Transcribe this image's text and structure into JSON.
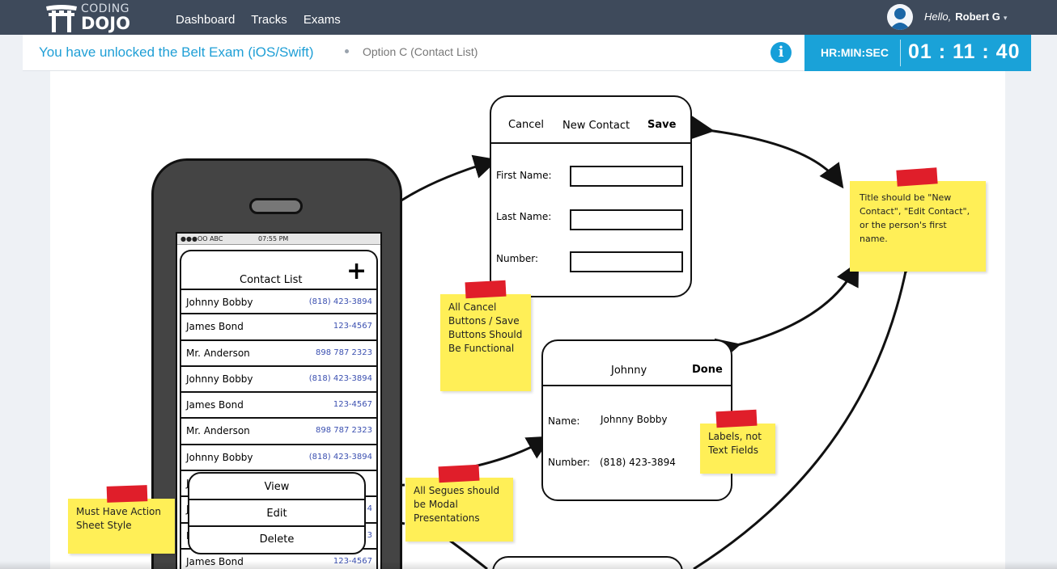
{
  "brand": {
    "line1": "CODING",
    "line2": "DOJO",
    "registered": "®"
  },
  "nav": {
    "links": [
      "Dashboard",
      "Tracks",
      "Exams"
    ]
  },
  "user": {
    "greeting": "Hello,",
    "name": "Robert G",
    "caret": "▾"
  },
  "exam_bar": {
    "unlocked_text": "You have unlocked the Belt Exam (iOS/Swift)",
    "option": "Option C (Contact List)",
    "info_icon": "i",
    "timer_label": "HR:MIN:SEC",
    "timer_value": "01 : 11 : 40"
  },
  "wireframe": {
    "phone": {
      "status_left": "●●●OO ABC",
      "status_time": "07:55 PM",
      "title": "Contact List",
      "add": "+",
      "contacts": [
        {
          "name": "Johnny Bobby",
          "number": "(818) 423-3894"
        },
        {
          "name": "James Bond",
          "number": "123-4567"
        },
        {
          "name": "Mr. Anderson",
          "number": "898 787 2323"
        },
        {
          "name": "Johnny Bobby",
          "number": "(818) 423-3894"
        },
        {
          "name": "James Bond",
          "number": "123-4567"
        },
        {
          "name": "Mr. Anderson",
          "number": "898 787 2323"
        },
        {
          "name": "Johnny Bobby",
          "number": "(818) 423-3894"
        },
        {
          "name": "J",
          "number": ""
        },
        {
          "name": "J",
          "number": "4"
        },
        {
          "name": "M",
          "number": "3"
        },
        {
          "name": "James Bond",
          "number": "123-4567"
        }
      ],
      "action_sheet": [
        "View",
        "Edit",
        "Delete"
      ]
    },
    "new_contact": {
      "cancel": "Cancel",
      "title": "New Contact",
      "save": "Save",
      "fields": [
        "First Name:",
        "Last Name:",
        "Number:"
      ]
    },
    "detail": {
      "title": "Johnny",
      "done": "Done",
      "name_label": "Name:",
      "name_value": "Johnny Bobby",
      "number_label": "Number:",
      "number_value": "(818) 423-3894"
    },
    "notes": {
      "title_note": "Title should be \"New Contact\", \"Edit Contact\", or the person's first name.",
      "cancel_note": "All Cancel Buttons / Save Buttons Should Be Functional",
      "labels_note": "Labels, not Text Fields",
      "segues_note": "All Segues should be Modal Presentations",
      "action_note": "Must Have Action Sheet Style"
    }
  },
  "colors": {
    "nav_bg": "#3e4a5b",
    "accent": "#1aa2d8",
    "note_yellow": "#ffef57",
    "tape_red": "#e01e2a"
  }
}
